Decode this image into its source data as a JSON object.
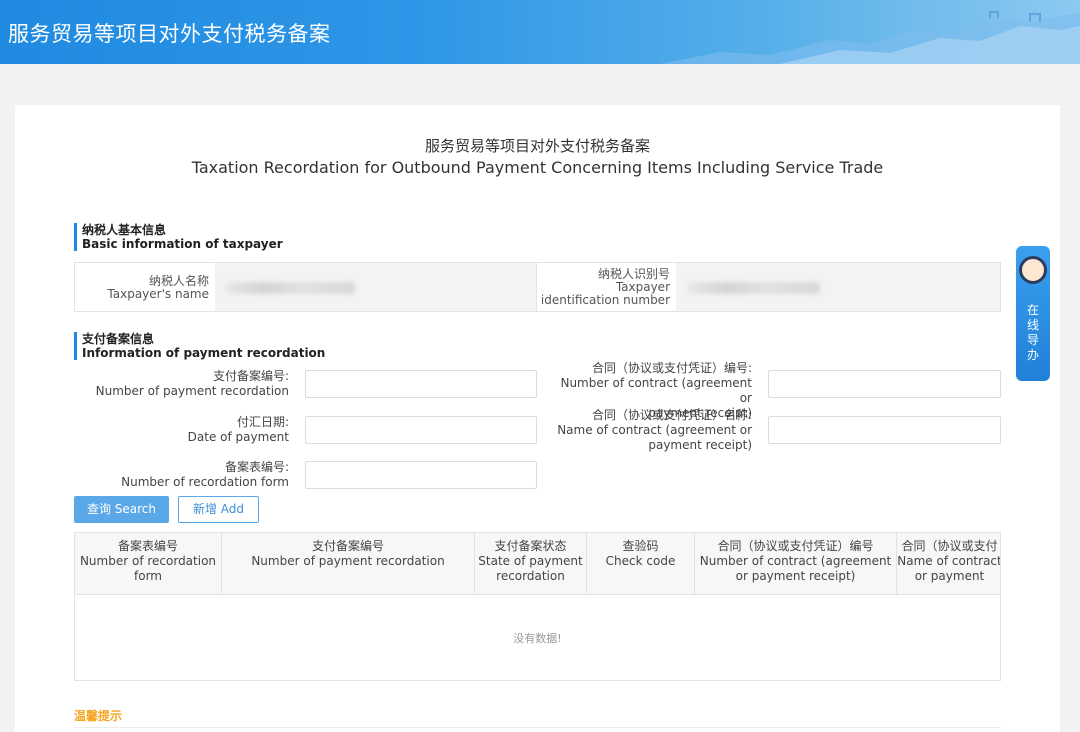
{
  "header": {
    "title": "服务贸易等项目对外支付税务备案"
  },
  "page": {
    "title_cn": "服务贸易等项目对外支付税务备案",
    "title_en": "Taxation Recordation for Outbound Payment Concerning Items Including Service Trade"
  },
  "basic_info": {
    "heading_cn": "纳税人基本信息",
    "heading_en": "Basic information of taxpayer",
    "name_label_cn": "纳税人名称",
    "name_label_en": "Taxpayer's name",
    "id_label_cn": "纳税人识别号",
    "id_label_en1": "Taxpayer",
    "id_label_en2": "identification number"
  },
  "payment_info": {
    "heading_cn": "支付备案信息",
    "heading_en": "Information of payment recordation",
    "fields": {
      "payment_no_cn": "支付备案编号:",
      "payment_no_en": "Number of payment recordation",
      "date_cn": "付汇日期:",
      "date_en": "Date of payment",
      "form_no_cn": "备案表编号:",
      "form_no_en": "Number of recordation form",
      "contract_no_cn": "合同（协议或支付凭证）编号:",
      "contract_no_en1": "Number of contract (agreement or",
      "contract_no_en2": "payment receipt)",
      "contract_name_cn": "合同（协议或支付凭证）名称:",
      "contract_name_en1": "Name of contract (agreement or",
      "contract_name_en2": "payment receipt)"
    }
  },
  "buttons": {
    "search": "查询 Search",
    "add": "新增 Add"
  },
  "table": {
    "columns": [
      {
        "cn": "备案表编号",
        "en1": "Number of recordation",
        "en2": "form"
      },
      {
        "cn": "支付备案编号",
        "en1": "Number of payment recordation",
        "en2": ""
      },
      {
        "cn": "支付备案状态",
        "en1": "State of payment",
        "en2": "recordation"
      },
      {
        "cn": "查验码",
        "en1": "Check code",
        "en2": ""
      },
      {
        "cn": "合同（协议或支付凭证）编号",
        "en1": "Number of contract (agreement",
        "en2": "or payment receipt)"
      },
      {
        "cn": "合同（协议或支付",
        "en1": "Name of contract",
        "en2": "or payment"
      }
    ],
    "empty_text": "没有数据!"
  },
  "tips": {
    "label": "温馨提示"
  },
  "side_button": {
    "label": "在线导办",
    "chars": [
      "在",
      "线",
      "导",
      "办"
    ]
  },
  "colors": {
    "accent": "#1e88e5",
    "banner": "#2f97e8",
    "tips": "#f5a623",
    "button": "#5ba8e8"
  }
}
